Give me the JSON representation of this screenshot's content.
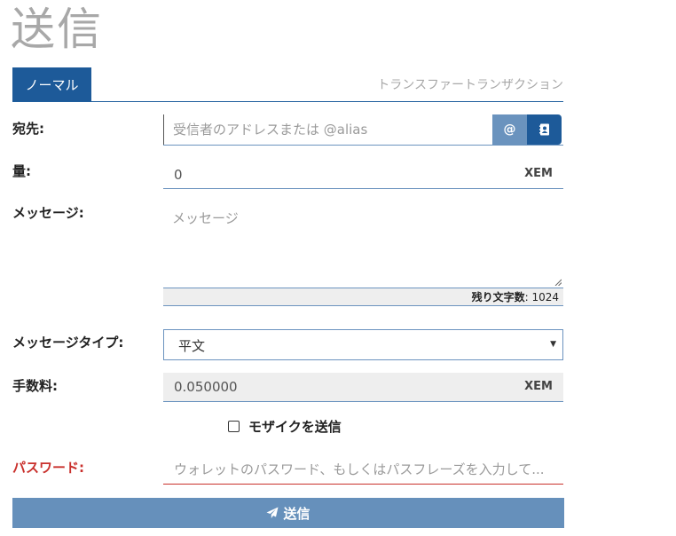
{
  "page": {
    "title": "送信"
  },
  "tabs": {
    "active_label": "ノーマル",
    "description": "トランスファートランザクション"
  },
  "recipient": {
    "label": "宛先:",
    "placeholder": "受信者のアドレスまたは @alias",
    "alias_button": "@",
    "contacts_icon": "address-book-icon"
  },
  "amount": {
    "label": "量:",
    "value": "0",
    "unit": "XEM"
  },
  "message": {
    "label": "メッセージ:",
    "placeholder": "メッセージ",
    "chars_left_label": "残り文字数",
    "chars_left_value": ": 1024"
  },
  "message_type": {
    "label": "メッセージタイプ:",
    "selected": "平文"
  },
  "fee": {
    "label": "手数料:",
    "value": "0.050000",
    "unit": "XEM"
  },
  "mosaic": {
    "label": "モザイクを送信",
    "checked": false
  },
  "password": {
    "label": "パスワード:",
    "placeholder": "ウォレットのパスワード、もしくはパスフレーズを入力して..."
  },
  "send": {
    "label": "送信",
    "icon": "paper-plane-icon"
  },
  "colors": {
    "primary": "#1d5a99",
    "button": "#6690bb",
    "error": "#c9302c",
    "title": "#a8a8a8"
  }
}
